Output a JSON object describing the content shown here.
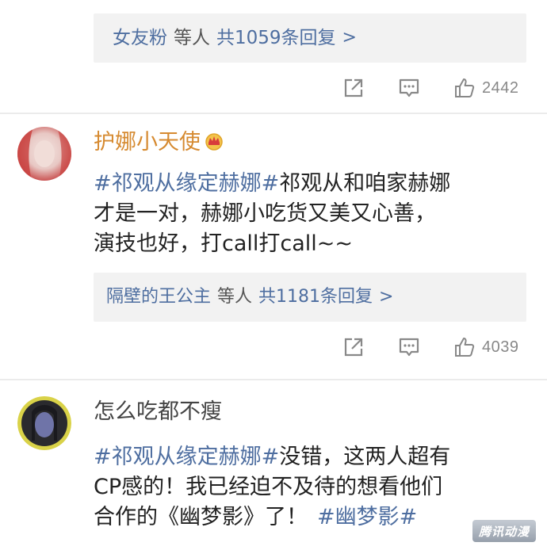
{
  "thread1": {
    "reply_summary": {
      "users": "女友粉",
      "mid": "等人",
      "count": "共1059条回复",
      "chevron": ">"
    },
    "actions": {
      "like_count": "2442"
    }
  },
  "comment2": {
    "username": "护娜小天使",
    "username_color": "#d68a30",
    "lines": [
      {
        "tag": "#祁观从缘定赫娜#",
        "text": "祁观从和咱家赫娜"
      },
      {
        "tag": "",
        "text": "才是一对，赫娜小吃货又美又心善，"
      },
      {
        "tag": "",
        "text": "演技也好，打call打call~~"
      }
    ],
    "reply_summary": {
      "users": "隔壁的王公主",
      "mid": "等人",
      "count": "共1181条回复",
      "chevron": ">"
    },
    "actions": {
      "like_count": "4039"
    }
  },
  "comment3": {
    "username": "怎么吃都不瘦",
    "username_color": "#444444",
    "line1_tag": "#祁观从缘定赫娜#",
    "line1_text": "没错，这两人超有",
    "line2_text": "CP感的！我已经迫不及待的想看他们",
    "line3_text": "合作的《幽梦影》了！",
    "line3_tag": "#幽梦影#"
  },
  "watermark": {
    "text": "腾讯动漫"
  },
  "colors": {
    "link_blue": "#4e6ea0",
    "reply_bg": "#f2f2f2",
    "icon_gray": "#888888"
  }
}
